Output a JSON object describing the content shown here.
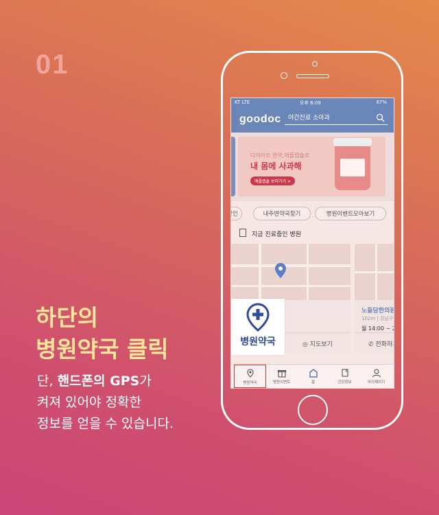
{
  "step": "01",
  "headline": [
    "하단의",
    "병원약국 클릭"
  ],
  "description": {
    "line1_pre": "단, ",
    "line1_bold": "핸드폰의 GPS",
    "line1_post": "가",
    "line2": "켜져 있어야 정확한",
    "line3": "정보를 얻을 수 있습니다."
  },
  "phone": {
    "status": {
      "carrier": "KT  LTE",
      "time": "오후 6:09",
      "battery": "67%"
    },
    "app": {
      "logo": "goodoc",
      "search_placeholder": "야간진료 소아과",
      "banner": {
        "subtitle": "다이어트 한약,애플캡슐로",
        "title": "내 몸에 사과해",
        "button": "애플캡슐 보러가기 >"
      },
      "chips": [
        "찾인",
        "내주변약국찾기",
        "병원이벤트모아보기"
      ],
      "section_title": "지금 진료중인 병원",
      "card_left": {
        "map_action": "지도보기"
      },
      "card_right": {
        "name": "노들담한의원",
        "meta": "102m | 강남구 |",
        "hours": "월 14:00 ~ 2",
        "action": "전화하기"
      },
      "pharmacy_badge": "병원약국",
      "tabs": [
        {
          "label": "병원약국",
          "icon": "location-pin-icon"
        },
        {
          "label": "병원이벤트",
          "icon": "gift-icon"
        },
        {
          "label": "홈",
          "icon": "home-icon"
        },
        {
          "label": "건강정보",
          "icon": "bookmark-icon"
        },
        {
          "label": "마이페이지",
          "icon": "person-icon"
        }
      ]
    }
  },
  "colors": {
    "headline": "#ffe69a",
    "app_header": "#6a86b8",
    "highlight": "#d9342b",
    "badge_text": "#2f4a9a"
  }
}
